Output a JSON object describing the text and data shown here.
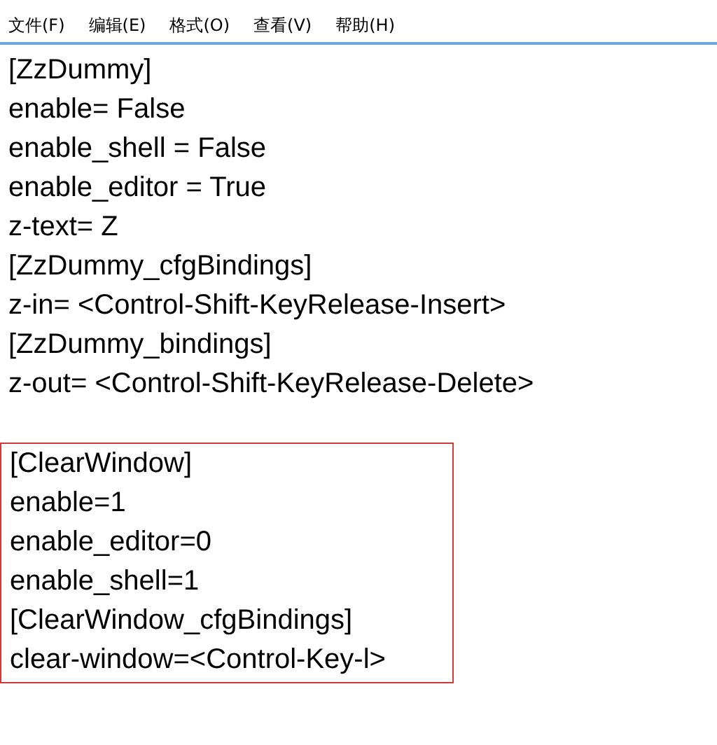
{
  "menu": [
    "文件(F)",
    "编辑(E)",
    "格式(O)",
    "查看(V)",
    "帮助(H)"
  ],
  "editor": {
    "lines": [
      "[ZzDummy]",
      "enable= False",
      "enable_shell = False",
      "enable_editor = True",
      "z-text= Z",
      "[ZzDummy_cfgBindings]",
      "z-in= <Control-Shift-KeyRelease-Insert>",
      "[ZzDummy_bindings]",
      "z-out= <Control-Shift-KeyRelease-Delete>"
    ]
  },
  "highlighted_block": {
    "lines": [
      "[ClearWindow]",
      "enable=1",
      "enable_editor=0",
      "enable_shell=1",
      "[ClearWindow_cfgBindings]",
      "clear-window=<Control-Key-l>"
    ]
  }
}
